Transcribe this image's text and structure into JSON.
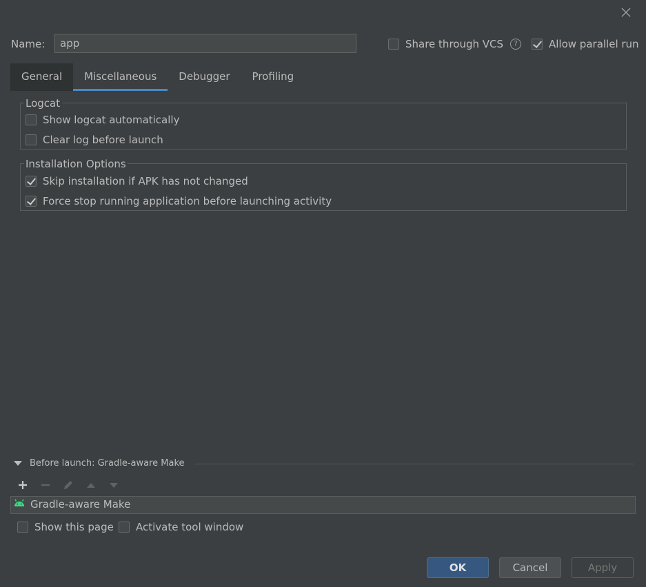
{
  "dialog": {
    "name_label": "Name:",
    "name_value": "app",
    "share_vcs": {
      "label": "Share through VCS",
      "checked": false
    },
    "help_glyph": "?",
    "allow_parallel": {
      "label": "Allow parallel run",
      "checked": true
    }
  },
  "tabs": [
    {
      "label": "General"
    },
    {
      "label": "Miscellaneous"
    },
    {
      "label": "Debugger"
    },
    {
      "label": "Profiling"
    }
  ],
  "logcat": {
    "title": "Logcat",
    "options": [
      {
        "label": "Show logcat automatically",
        "checked": false
      },
      {
        "label": "Clear log before launch",
        "checked": false
      }
    ]
  },
  "installation": {
    "title": "Installation Options",
    "options": [
      {
        "label": "Skip installation if APK has not changed",
        "checked": true
      },
      {
        "label": "Force stop running application before launching activity",
        "checked": true
      }
    ]
  },
  "before_launch": {
    "title": "Before launch: Gradle-aware Make",
    "tools": [
      "add-icon",
      "remove-icon",
      "edit-icon",
      "move-up-icon",
      "move-down-icon"
    ],
    "tasks": [
      {
        "label": "Gradle-aware Make",
        "icon": "android-icon"
      }
    ],
    "show_page": {
      "label": "Show this page",
      "checked": false
    },
    "activate_tool_window": {
      "label": "Activate tool window",
      "checked": false
    }
  },
  "buttons": {
    "ok": "OK",
    "cancel": "Cancel",
    "apply": "Apply"
  },
  "colors": {
    "accent": "#4a88c7",
    "ok_button": "#365880",
    "android_green": "#3ddc84",
    "background": "#3c3f41"
  }
}
